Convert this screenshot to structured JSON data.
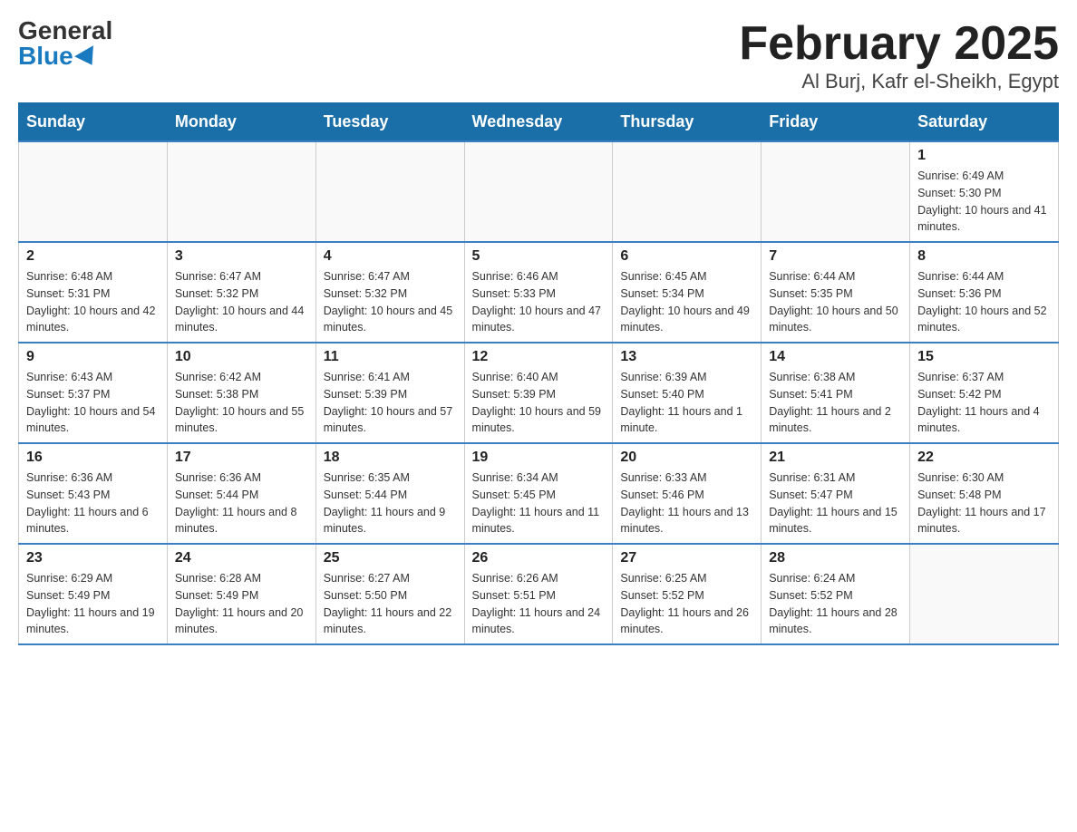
{
  "logo": {
    "general": "General",
    "blue": "Blue"
  },
  "title": "February 2025",
  "location": "Al Burj, Kafr el-Sheikh, Egypt",
  "weekdays": [
    "Sunday",
    "Monday",
    "Tuesday",
    "Wednesday",
    "Thursday",
    "Friday",
    "Saturday"
  ],
  "weeks": [
    [
      {
        "day": "",
        "info": ""
      },
      {
        "day": "",
        "info": ""
      },
      {
        "day": "",
        "info": ""
      },
      {
        "day": "",
        "info": ""
      },
      {
        "day": "",
        "info": ""
      },
      {
        "day": "",
        "info": ""
      },
      {
        "day": "1",
        "info": "Sunrise: 6:49 AM\nSunset: 5:30 PM\nDaylight: 10 hours and 41 minutes."
      }
    ],
    [
      {
        "day": "2",
        "info": "Sunrise: 6:48 AM\nSunset: 5:31 PM\nDaylight: 10 hours and 42 minutes."
      },
      {
        "day": "3",
        "info": "Sunrise: 6:47 AM\nSunset: 5:32 PM\nDaylight: 10 hours and 44 minutes."
      },
      {
        "day": "4",
        "info": "Sunrise: 6:47 AM\nSunset: 5:32 PM\nDaylight: 10 hours and 45 minutes."
      },
      {
        "day": "5",
        "info": "Sunrise: 6:46 AM\nSunset: 5:33 PM\nDaylight: 10 hours and 47 minutes."
      },
      {
        "day": "6",
        "info": "Sunrise: 6:45 AM\nSunset: 5:34 PM\nDaylight: 10 hours and 49 minutes."
      },
      {
        "day": "7",
        "info": "Sunrise: 6:44 AM\nSunset: 5:35 PM\nDaylight: 10 hours and 50 minutes."
      },
      {
        "day": "8",
        "info": "Sunrise: 6:44 AM\nSunset: 5:36 PM\nDaylight: 10 hours and 52 minutes."
      }
    ],
    [
      {
        "day": "9",
        "info": "Sunrise: 6:43 AM\nSunset: 5:37 PM\nDaylight: 10 hours and 54 minutes."
      },
      {
        "day": "10",
        "info": "Sunrise: 6:42 AM\nSunset: 5:38 PM\nDaylight: 10 hours and 55 minutes."
      },
      {
        "day": "11",
        "info": "Sunrise: 6:41 AM\nSunset: 5:39 PM\nDaylight: 10 hours and 57 minutes."
      },
      {
        "day": "12",
        "info": "Sunrise: 6:40 AM\nSunset: 5:39 PM\nDaylight: 10 hours and 59 minutes."
      },
      {
        "day": "13",
        "info": "Sunrise: 6:39 AM\nSunset: 5:40 PM\nDaylight: 11 hours and 1 minute."
      },
      {
        "day": "14",
        "info": "Sunrise: 6:38 AM\nSunset: 5:41 PM\nDaylight: 11 hours and 2 minutes."
      },
      {
        "day": "15",
        "info": "Sunrise: 6:37 AM\nSunset: 5:42 PM\nDaylight: 11 hours and 4 minutes."
      }
    ],
    [
      {
        "day": "16",
        "info": "Sunrise: 6:36 AM\nSunset: 5:43 PM\nDaylight: 11 hours and 6 minutes."
      },
      {
        "day": "17",
        "info": "Sunrise: 6:36 AM\nSunset: 5:44 PM\nDaylight: 11 hours and 8 minutes."
      },
      {
        "day": "18",
        "info": "Sunrise: 6:35 AM\nSunset: 5:44 PM\nDaylight: 11 hours and 9 minutes."
      },
      {
        "day": "19",
        "info": "Sunrise: 6:34 AM\nSunset: 5:45 PM\nDaylight: 11 hours and 11 minutes."
      },
      {
        "day": "20",
        "info": "Sunrise: 6:33 AM\nSunset: 5:46 PM\nDaylight: 11 hours and 13 minutes."
      },
      {
        "day": "21",
        "info": "Sunrise: 6:31 AM\nSunset: 5:47 PM\nDaylight: 11 hours and 15 minutes."
      },
      {
        "day": "22",
        "info": "Sunrise: 6:30 AM\nSunset: 5:48 PM\nDaylight: 11 hours and 17 minutes."
      }
    ],
    [
      {
        "day": "23",
        "info": "Sunrise: 6:29 AM\nSunset: 5:49 PM\nDaylight: 11 hours and 19 minutes."
      },
      {
        "day": "24",
        "info": "Sunrise: 6:28 AM\nSunset: 5:49 PM\nDaylight: 11 hours and 20 minutes."
      },
      {
        "day": "25",
        "info": "Sunrise: 6:27 AM\nSunset: 5:50 PM\nDaylight: 11 hours and 22 minutes."
      },
      {
        "day": "26",
        "info": "Sunrise: 6:26 AM\nSunset: 5:51 PM\nDaylight: 11 hours and 24 minutes."
      },
      {
        "day": "27",
        "info": "Sunrise: 6:25 AM\nSunset: 5:52 PM\nDaylight: 11 hours and 26 minutes."
      },
      {
        "day": "28",
        "info": "Sunrise: 6:24 AM\nSunset: 5:52 PM\nDaylight: 11 hours and 28 minutes."
      },
      {
        "day": "",
        "info": ""
      }
    ]
  ]
}
